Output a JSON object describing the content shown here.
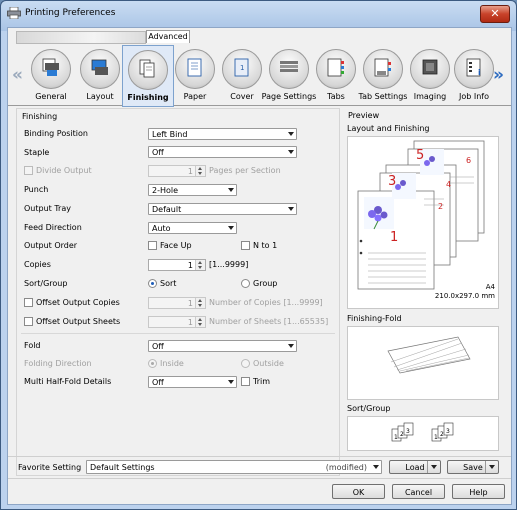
{
  "window": {
    "title": "Printing Preferences",
    "close_glyph": "✕"
  },
  "top_tabs": {
    "hidden_tab": "",
    "advanced": "Advanced"
  },
  "categories": [
    {
      "label": "General",
      "icon": "general-icon"
    },
    {
      "label": "Layout",
      "icon": "layout-icon"
    },
    {
      "label": "Finishing",
      "icon": "finishing-icon",
      "selected": true
    },
    {
      "label": "Paper",
      "icon": "paper-icon"
    },
    {
      "label": "Cover",
      "icon": "cover-icon"
    },
    {
      "label": "Page Settings",
      "icon": "page-settings-icon"
    },
    {
      "label": "Tabs",
      "icon": "tabs-icon"
    },
    {
      "label": "Tab Settings",
      "icon": "tab-settings-icon"
    },
    {
      "label": "Imaging",
      "icon": "imaging-icon"
    },
    {
      "label": "Job Info",
      "icon": "job-info-icon"
    }
  ],
  "nav": {
    "left": "«",
    "right": "»"
  },
  "finishing": {
    "group_title": "Finishing",
    "binding_position": {
      "label": "Binding Position",
      "value": "Left Bind"
    },
    "staple": {
      "label": "Staple",
      "value": "Off"
    },
    "divide_output": {
      "label": "Divide Output",
      "value": "1",
      "unit": "Pages per Section"
    },
    "punch": {
      "label": "Punch",
      "value": "2-Hole"
    },
    "output_tray": {
      "label": "Output Tray",
      "value": "Default"
    },
    "feed_direction": {
      "label": "Feed Direction",
      "value": "Auto"
    },
    "output_order": {
      "label": "Output Order",
      "face_up": "Face Up",
      "n_to_1": "N to 1"
    },
    "copies": {
      "label": "Copies",
      "value": "1",
      "range": "[1...9999]"
    },
    "sort_group": {
      "label": "Sort/Group",
      "sort": "Sort",
      "group": "Group"
    },
    "offset_output_copies": {
      "label": "Offset Output Copies",
      "value": "1",
      "unit": "Number of Copies [1...9999]"
    },
    "offset_output_sheets": {
      "label": "Offset Output Sheets",
      "value": "1",
      "unit": "Number of Sheets [1...65535]"
    },
    "fold": {
      "label": "Fold",
      "value": "Off"
    },
    "folding_direction": {
      "label": "Folding Direction",
      "inside": "Inside",
      "outside": "Outside"
    },
    "multi_half_fold": {
      "label": "Multi Half-Fold Details",
      "value": "Off",
      "trim": "Trim"
    }
  },
  "preview": {
    "title": "Preview",
    "layout_title": "Layout and Finishing",
    "paper_size": "A4",
    "paper_dims": "210.0x297.0 mm",
    "page_numbers": [
      "1",
      "2",
      "3",
      "4",
      "5",
      "6"
    ],
    "finishing_fold_title": "Finishing-Fold",
    "sort_group_title": "Sort/Group",
    "sort_group_numbers": [
      "1",
      "2",
      "3",
      "1",
      "2",
      "3"
    ]
  },
  "favorite": {
    "label": "Favorite Setting",
    "value": "Default Settings",
    "status": "(modified)",
    "load": "Load",
    "save": "Save"
  },
  "buttons": {
    "ok": "OK",
    "cancel": "Cancel",
    "help": "Help"
  }
}
